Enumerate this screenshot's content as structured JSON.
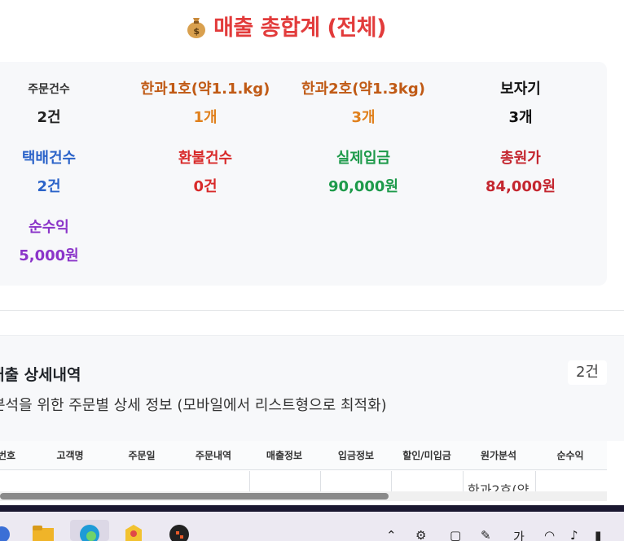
{
  "header": {
    "title": "매출 총합계 (전체)",
    "icon": "money-bag-icon"
  },
  "summary": {
    "order_count": {
      "label": "주문건수",
      "value": "2건"
    },
    "hangwa1": {
      "label": "한과1호(약1.1.kg)",
      "value": "1개"
    },
    "hangwa2": {
      "label": "한과2호(약1.3kg)",
      "value": "3개"
    },
    "bojagi": {
      "label": "보자기",
      "value": "3개"
    },
    "delivery_count": {
      "label": "택배건수",
      "value": "2건"
    },
    "refund_count": {
      "label": "환불건수",
      "value": "0건"
    },
    "actual_deposit": {
      "label": "실제입금",
      "value": "90,000원"
    },
    "total_cost": {
      "label": "총원가",
      "value": "84,000원"
    },
    "net_profit": {
      "label": "순수익",
      "value": "5,000원"
    }
  },
  "colors": {
    "title": "#e23b3b",
    "orange": "#d9761a",
    "brown_orange": "#c05a15",
    "blue": "#2b63c9",
    "red": "#d82a2a",
    "green": "#1d9a4a",
    "crimson": "#c4262f",
    "purple": "#8b35c9"
  },
  "detail": {
    "title": "매출 상세내역",
    "subtitle": "분석을 위한 주문별 상세 정보 (모바일에서 리스트형으로 최적화)",
    "count": "2건",
    "columns": [
      "번호",
      "고객명",
      "주문일",
      "주문내역",
      "매출정보",
      "입금정보",
      "할인/미입금",
      "원가분석",
      "순수익"
    ],
    "partial_cell": "한과2호(약"
  }
}
